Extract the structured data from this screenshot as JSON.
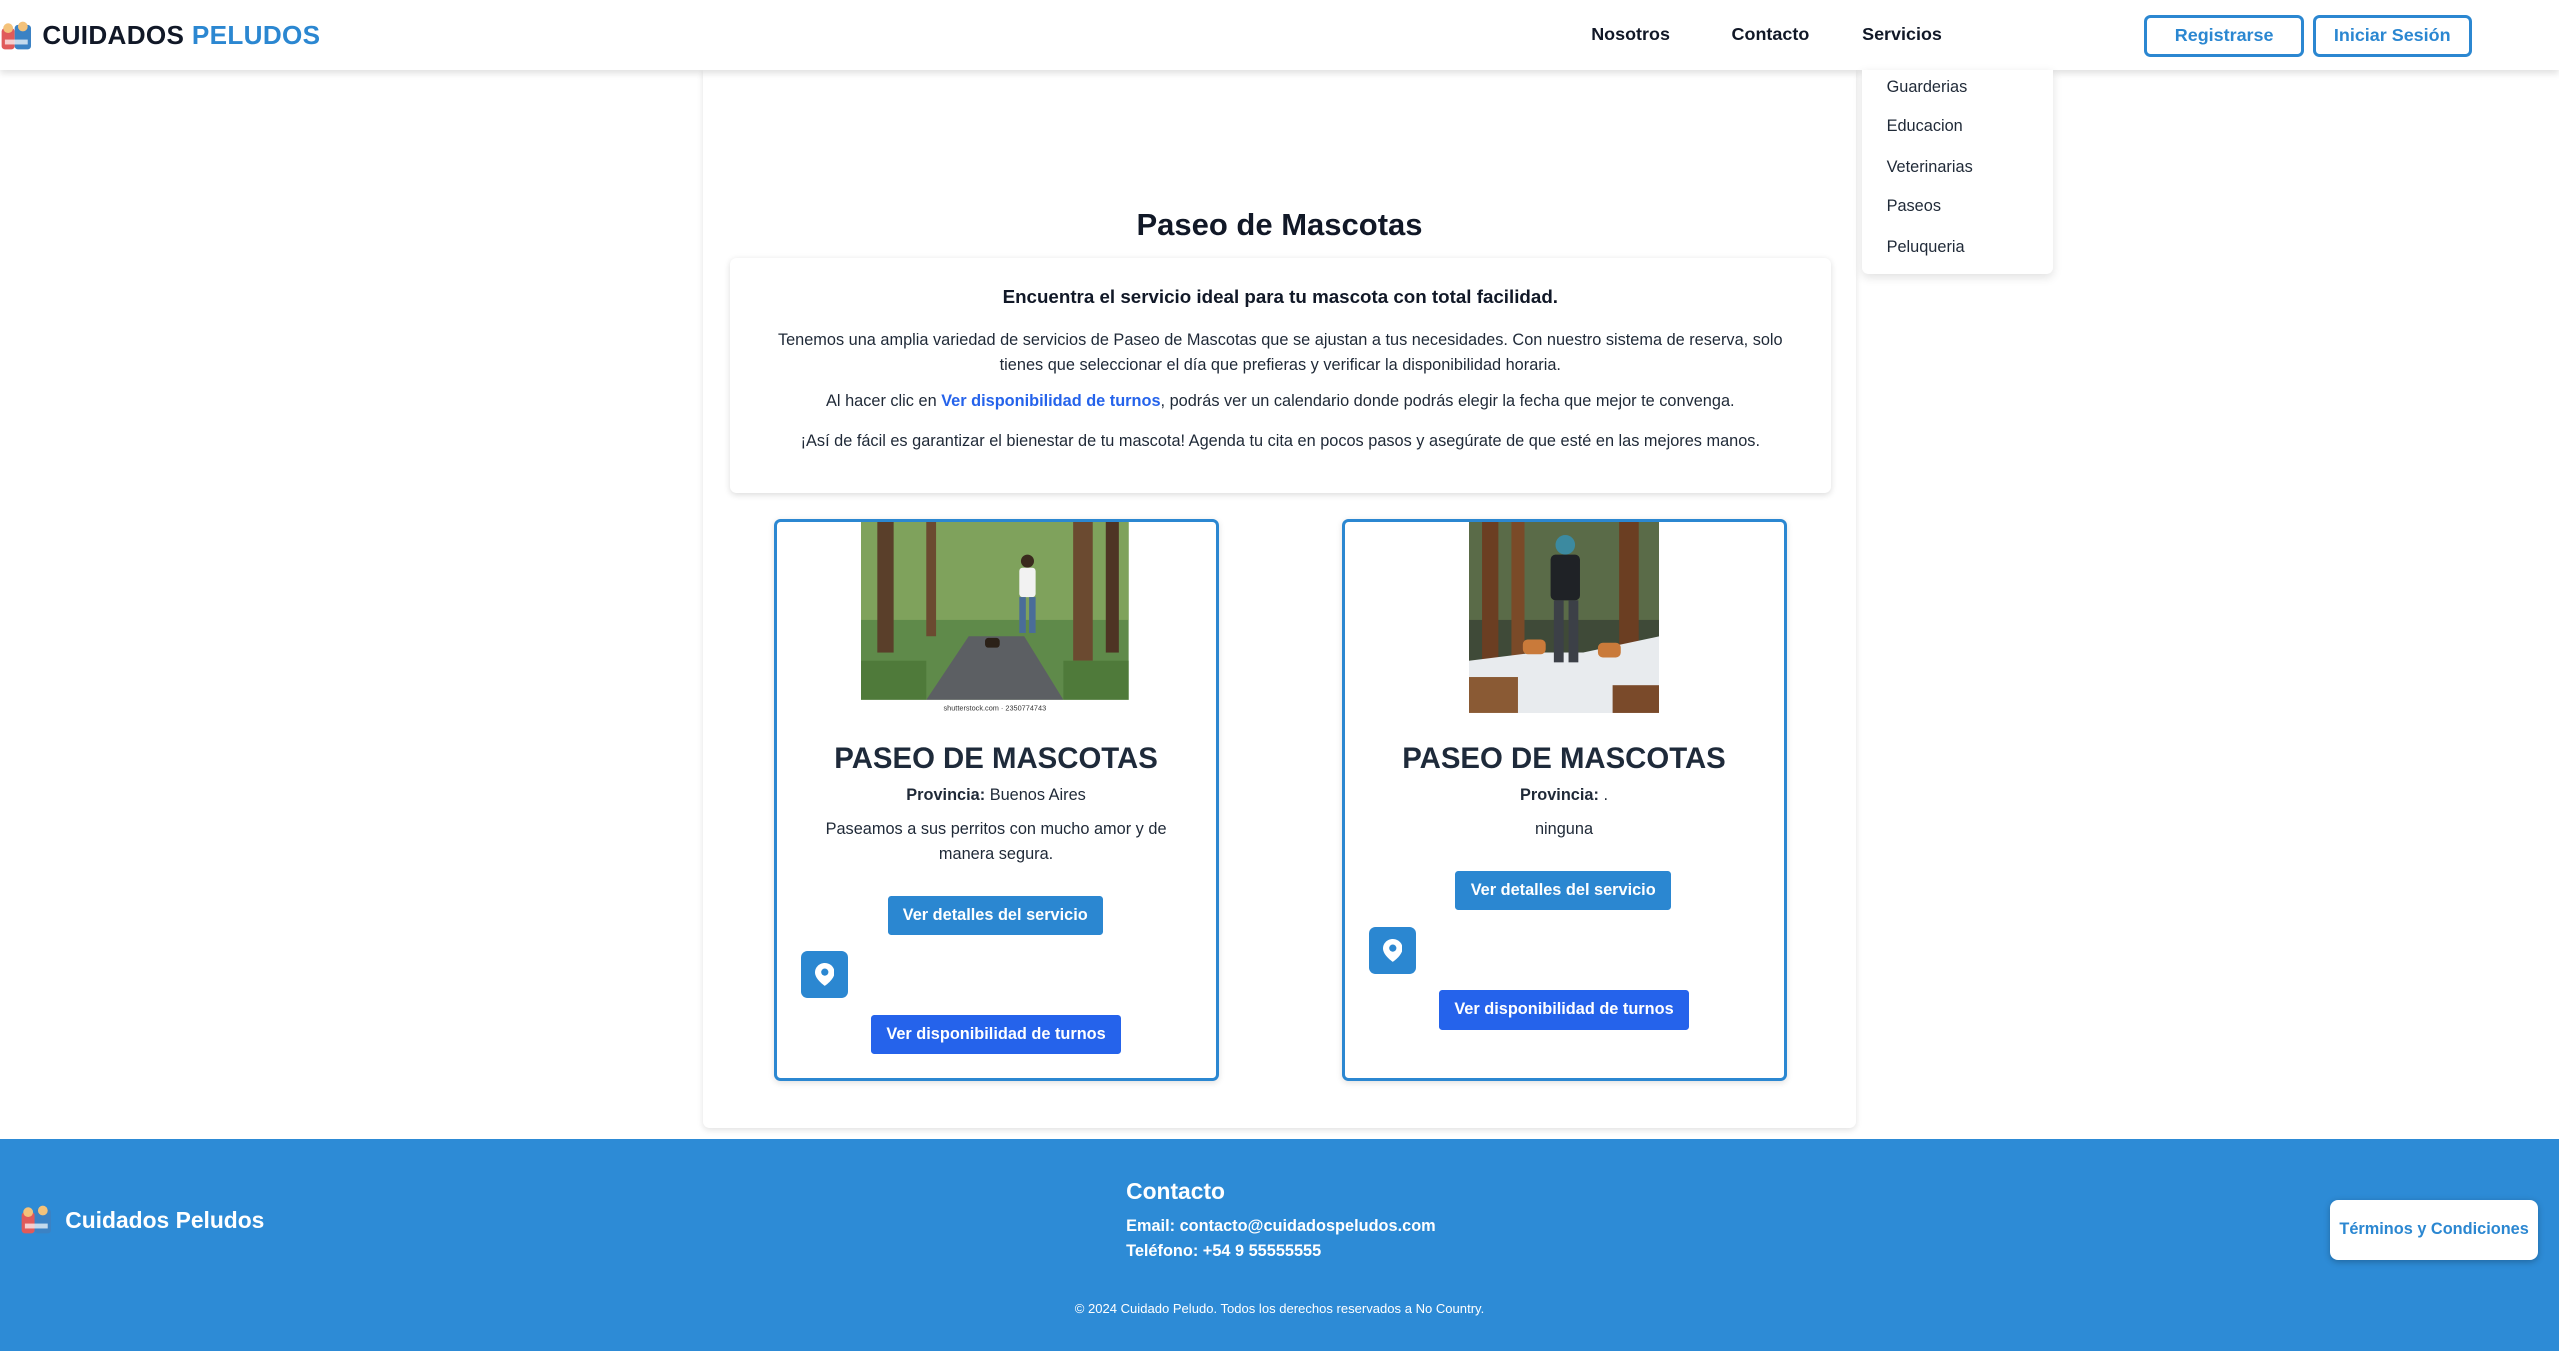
{
  "header": {
    "logo_primary": "CUIDADOS",
    "logo_secondary": "PELUDOS",
    "nav": {
      "about": "Nosotros",
      "contact": "Contacto",
      "services": "Servicios"
    },
    "register_label": "Registrarse",
    "login_label": "Iniciar Sesión"
  },
  "services_menu": {
    "items": [
      "Guarderias",
      "Educacion",
      "Veterinarias",
      "Paseos",
      "Peluqueria"
    ]
  },
  "page": {
    "title": "Paseo de Mascotas",
    "intro": {
      "lead": "Encuentra el servicio ideal para tu mascota con total facilidad.",
      "paragraph1": "Tenemos una amplia variedad de servicios de Paseo de Mascotas que se ajustan a tus necesidades. Con nuestro sistema de reserva, solo tienes que seleccionar el día que prefieras y verificar la disponibilidad horaria.",
      "paragraph2_before": "Al hacer clic en ",
      "paragraph2_link": "Ver disponibilidad de turnos",
      "paragraph2_after": ", podrás ver un calendario donde podrás elegir la fecha que mejor te convenga.",
      "paragraph3": "¡Así de fácil es garantizar el bienestar de tu mascota! Agenda tu cita en pocos pasos y asegúrate de que esté en las mejores manos."
    }
  },
  "services": [
    {
      "title": "PASEO DE MASCOTAS",
      "province_label": "Provincia:",
      "province": "Buenos Aires",
      "description": "Paseamos a sus perritos con mucho amor y de manera segura.",
      "image_caption": "shutterstock.com · 2350774743",
      "details_label": "Ver detalles del servicio",
      "availability_label": "Ver disponibilidad de turnos"
    },
    {
      "title": "PASEO DE MASCOTAS",
      "province_label": "Provincia:",
      "province": ".",
      "description": "ninguna",
      "details_label": "Ver detalles del servicio",
      "availability_label": "Ver disponibilidad de turnos"
    }
  ],
  "footer": {
    "brand": "Cuidados Peludos",
    "contact_title": "Contacto",
    "email": "Email: contacto@cuidadospeludos.com",
    "phone": "Teléfono: +54 9 55555555",
    "copyright": "© 2024 Cuidado Peludo. Todos los derechos reservados a No Country.",
    "terms_label": "Términos y Condiciones"
  },
  "colors": {
    "primary": "#2b87d1",
    "royal": "#2563eb",
    "footer_bg": "#2d8bd6"
  }
}
